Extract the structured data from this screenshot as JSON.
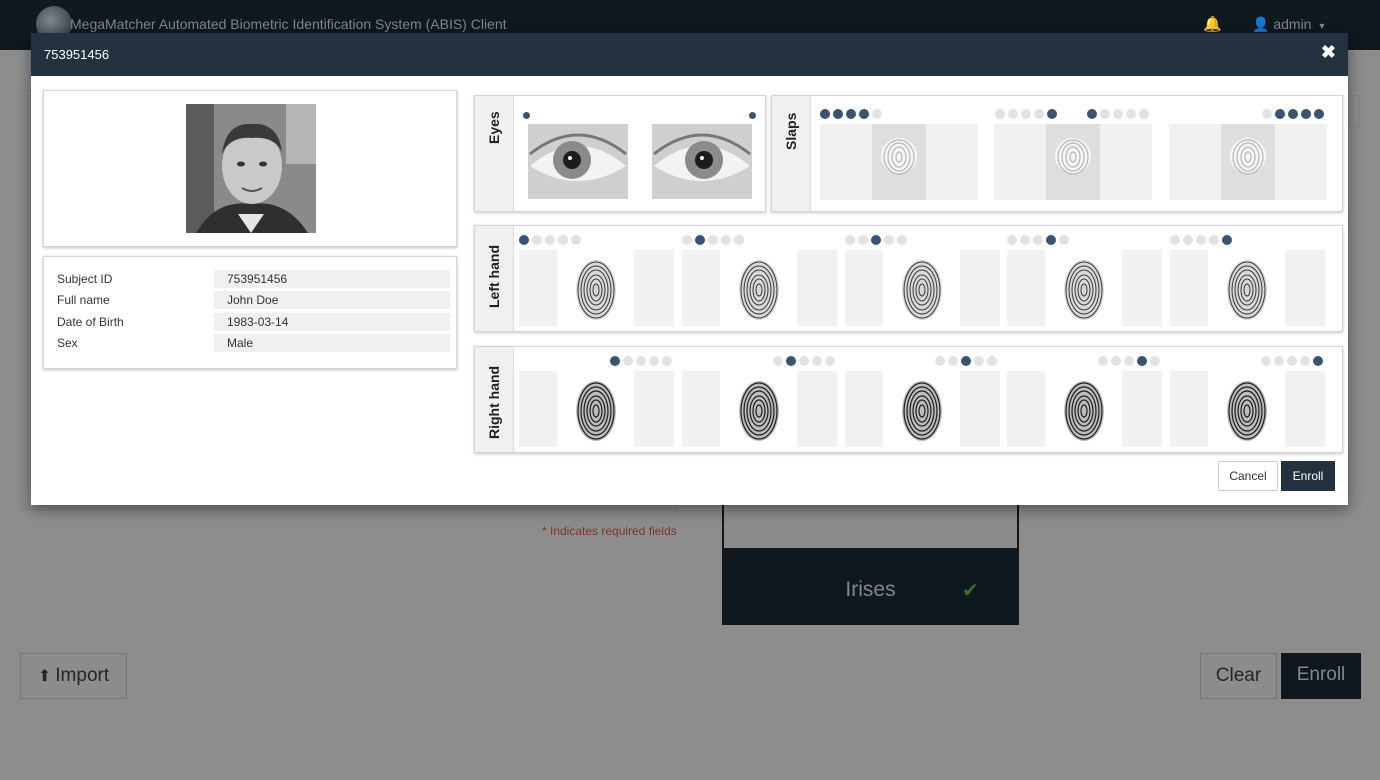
{
  "app": {
    "title": "MegaMatcher Automated Biometric Identification System (ABIS) Client",
    "user": "admin"
  },
  "background": {
    "required_note": "* Indicates required fields",
    "irises_label": "Irises",
    "import_label": "Import",
    "clear_label": "Clear",
    "enroll_label": "Enroll"
  },
  "modal": {
    "title": "753951456",
    "subject": [
      {
        "label": "Subject ID",
        "value": "753951456"
      },
      {
        "label": "Full name",
        "value": "John Doe"
      },
      {
        "label": "Date of Birth",
        "value": "1983-03-14"
      },
      {
        "label": "Sex",
        "value": "Male"
      }
    ],
    "panels": {
      "eyes": "Eyes",
      "slaps": "Slaps",
      "left_hand": "Left hand",
      "right_hand": "Right hand"
    },
    "cancel_label": "Cancel",
    "enroll_label": "Enroll"
  },
  "icons": {
    "close": "close-icon",
    "bell": "bell-icon",
    "user": "user-icon",
    "upload": "upload-icon",
    "check": "check-icon"
  },
  "colors": {
    "header": "#24313f",
    "accent": "#3a5470",
    "check": "#5aa83a"
  }
}
